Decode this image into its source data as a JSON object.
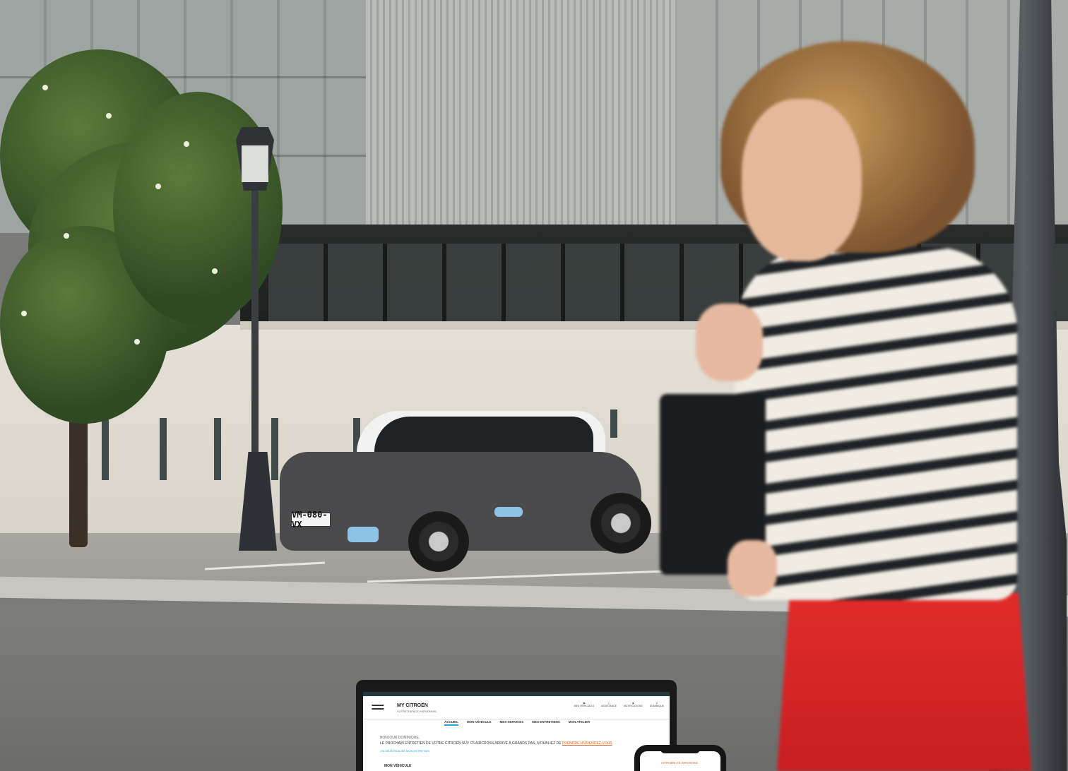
{
  "scene": {
    "plate_text": "VM-080-VX"
  },
  "laptop_screen": {
    "brand_title": "MY CITROËN",
    "brand_subtitle": "VOTRE ESPACE PERSONNEL",
    "header_icons": [
      {
        "name": "vehicle-icon",
        "label": "MES VÉHICULES"
      },
      {
        "name": "help-icon",
        "label": "ASSISTANCE"
      },
      {
        "name": "notification-icon",
        "label": "NOTIFICATIONS"
      },
      {
        "name": "user-icon",
        "label": "DOMINIQUE"
      }
    ],
    "nav": [
      "ACCUEIL",
      "MON VÉHICULE",
      "MES SERVICES",
      "MES ENTRETIENS",
      "MON ATELIER"
    ],
    "active_nav_index": 0,
    "greeting": "BONJOUR DOMINIQUE,",
    "message": "LE PROCHAIN ENTRETIEN DE VOTRE CITROËN SUV C5 AIRCROSS ARRIVE À GRANDS PAS, N'OUBLIEZ DE",
    "message_link": "PRENDRE UN RENDEZ-VOUS",
    "secondary_link": "J'AI DÉJÀ RÉALISÉ MON ENTRETIEN",
    "section_title": "MON VÉHICULE"
  },
  "phone_screen": {
    "title": "CITROËN C5 AIRCROSS"
  },
  "colors": {
    "accent_blue": "#2aa0d8",
    "accent_orange": "#e0602a",
    "skirt_red": "#e22b2b"
  }
}
